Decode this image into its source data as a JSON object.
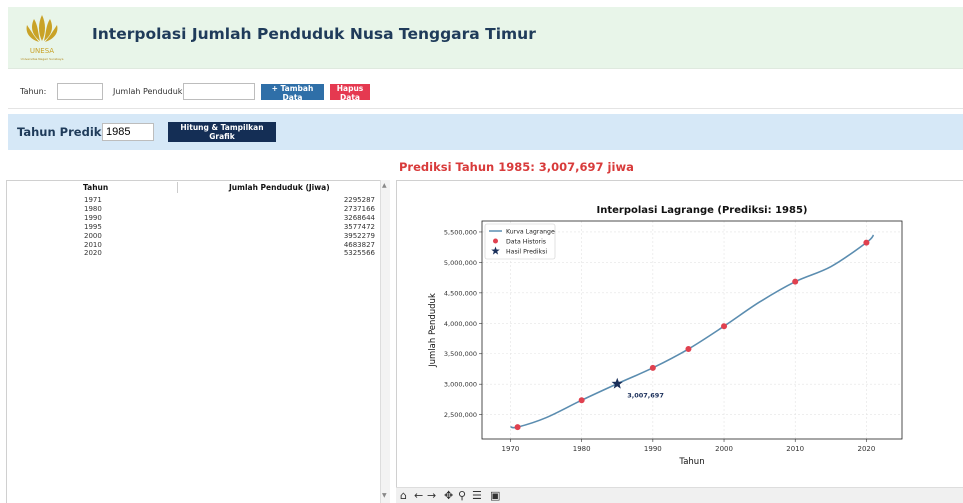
{
  "header": {
    "title": "Interpolasi Jumlah Penduduk Nusa Tenggara Timur",
    "logo_text": "UNESA",
    "logo_subtext": "Universitas Negeri Surabaya"
  },
  "input_form": {
    "tahun_label": "Tahun:",
    "tahun_value": "",
    "jumlah_label": "Jumlah Penduduk:",
    "jumlah_value": "",
    "add_button": "+ Tambah Data",
    "delete_button": "Hapus Data"
  },
  "prediction": {
    "label": "Tahun Prediksi:",
    "value": "1985",
    "button": "Hitung & Tampilkan Grafik",
    "result_text": "Prediksi Tahun 1985: 3,007,697 jiwa"
  },
  "table": {
    "columns": [
      "Tahun",
      "Jumlah Penduduk (Jiwa)"
    ],
    "rows": [
      [
        "1971",
        "2295287"
      ],
      [
        "1980",
        "2737166"
      ],
      [
        "1990",
        "3268644"
      ],
      [
        "1995",
        "3577472"
      ],
      [
        "2000",
        "3952279"
      ],
      [
        "2010",
        "4683827"
      ],
      [
        "2020",
        "5325566"
      ]
    ]
  },
  "colors": {
    "curve": "#5b8db0",
    "points": "#e0414f",
    "star": "#1a2f5a",
    "accent_red": "#e53950",
    "accent_blue": "#2f6fa8"
  },
  "chart_data": {
    "type": "line",
    "title": "Interpolasi Lagrange (Prediksi: 1985)",
    "xlabel": "Tahun",
    "ylabel": "Jumlah Penduduk",
    "xlim": [
      1966,
      2025
    ],
    "ylim": [
      2100000,
      5680000
    ],
    "xticks": [
      1970,
      1980,
      1990,
      2000,
      2010,
      2020
    ],
    "yticks": [
      2500000,
      3000000,
      3500000,
      4000000,
      4500000,
      5000000,
      5500000
    ],
    "ytick_labels": [
      "2,500,000",
      "3,000,000",
      "3,500,000",
      "4,000,000",
      "4,500,000",
      "5,000,000",
      "5,500,000"
    ],
    "grid": true,
    "legend_position": "top-left",
    "series": [
      {
        "name": "Kurva Lagrange",
        "kind": "line",
        "x": [
          1970,
          1971,
          1975,
          1980,
          1985,
          1990,
          1995,
          2000,
          2005,
          2010,
          2015,
          2020,
          2021
        ],
        "y": [
          2300000,
          2295287,
          2450000,
          2737166,
          3007697,
          3268644,
          3577472,
          3952279,
          4350000,
          4683827,
          4930000,
          5325566,
          5450000
        ]
      },
      {
        "name": "Data Historis",
        "kind": "scatter",
        "x": [
          1971,
          1980,
          1990,
          1995,
          2000,
          2010,
          2020
        ],
        "y": [
          2295287,
          2737166,
          3268644,
          3577472,
          3952279,
          4683827,
          5325566
        ]
      },
      {
        "name": "Hasil Prediksi",
        "kind": "star",
        "x": [
          1985
        ],
        "y": [
          3007697
        ]
      }
    ],
    "annotations": [
      {
        "x": 1985,
        "y": 3007697,
        "text": "3,007,697"
      }
    ]
  },
  "toolbar": {
    "icons": [
      "home-icon",
      "back-icon",
      "forward-icon",
      "pan-icon",
      "zoom-icon",
      "configure-icon",
      "save-icon"
    ]
  }
}
